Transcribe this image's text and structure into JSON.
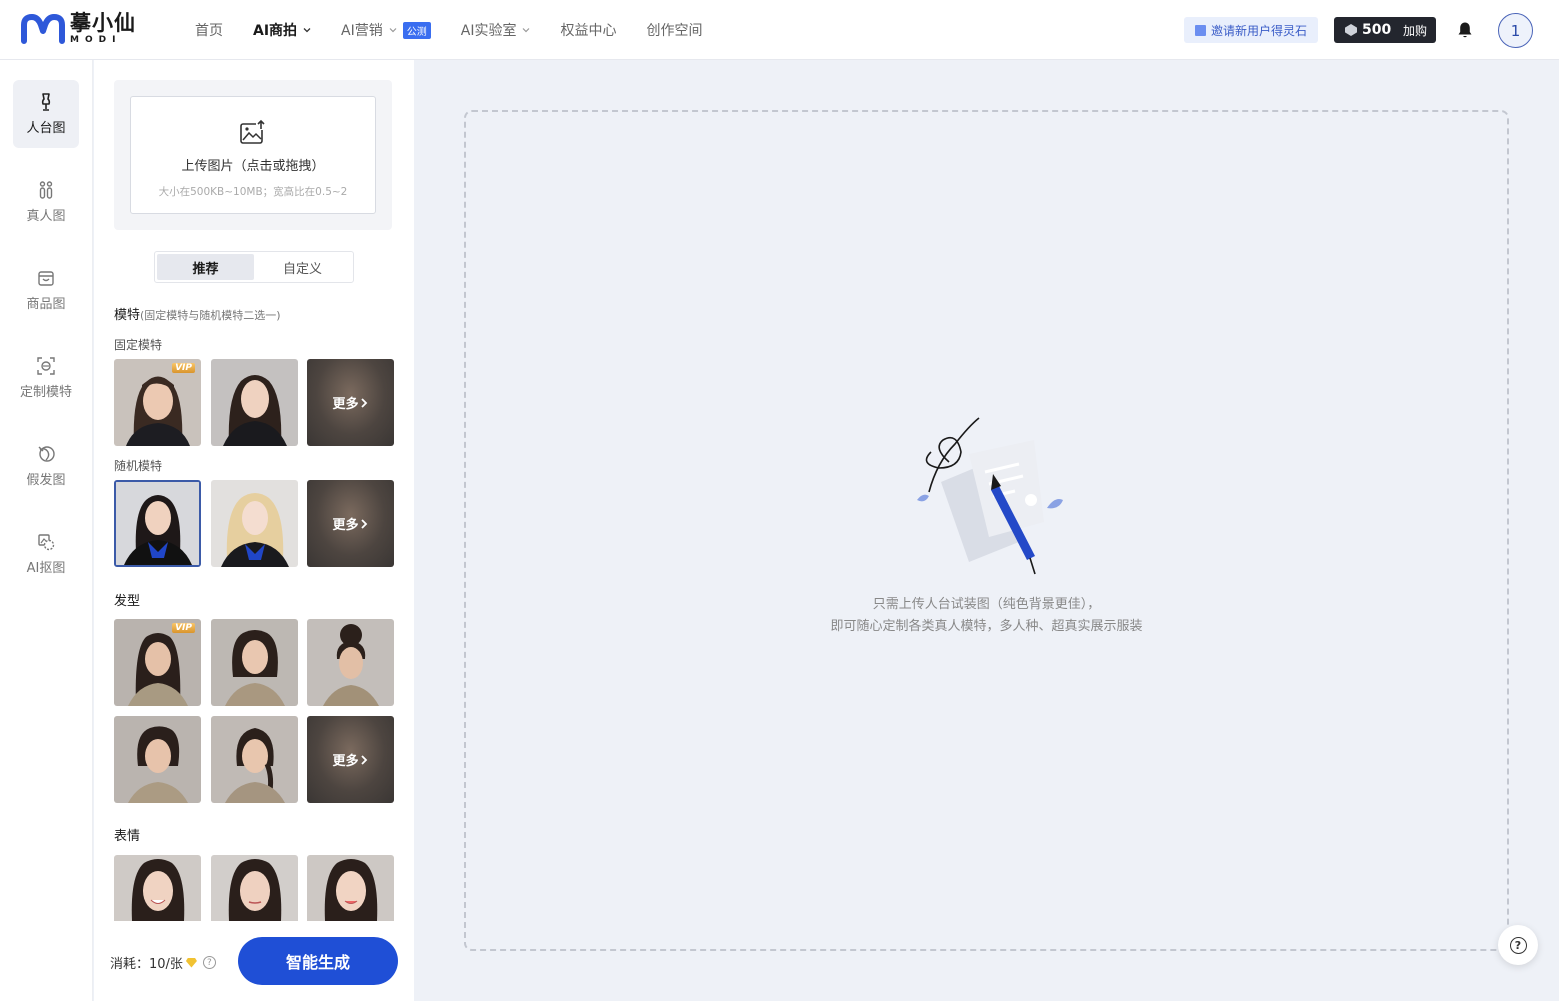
{
  "header": {
    "brand_cn": "摹小仙",
    "brand_en": "MODI",
    "nav": [
      {
        "label": "首页"
      },
      {
        "label": "AI商拍"
      },
      {
        "label": "AI营销",
        "badge": "公测"
      },
      {
        "label": "AI实验室"
      },
      {
        "label": "权益中心"
      },
      {
        "label": "创作空间"
      }
    ],
    "invite_label": "邀请新用户得灵石",
    "points_value": "500",
    "buy_label": "加购",
    "avatar_text": "1"
  },
  "sidebar": {
    "items": [
      {
        "label": "人台图",
        "icon": "mannequin-icon"
      },
      {
        "label": "真人图",
        "icon": "people-icon"
      },
      {
        "label": "商品图",
        "icon": "bag-icon"
      },
      {
        "label": "定制模特",
        "icon": "face-scan-icon"
      },
      {
        "label": "假发图",
        "icon": "wig-icon"
      },
      {
        "label": "AI抠图",
        "icon": "cutout-icon"
      }
    ],
    "active_index": 0
  },
  "panel": {
    "upload_title": "上传图片（点击或拖拽）",
    "upload_hint": "大小在500KB~10MB；宽高比在0.5~2",
    "tabs": [
      "推荐",
      "自定义"
    ],
    "model_title": "模特",
    "model_note": "(固定模特与随机模特二选一)",
    "fixed_model_label": "固定模特",
    "random_model_label": "随机模特",
    "hairstyle_label": "发型",
    "expression_label": "表情",
    "more_label": "更多",
    "vip_label": "VIP",
    "cost_label": "消耗：10/张",
    "generate_label": "智能生成"
  },
  "main": {
    "empty_line1": "只需上传人台试装图（纯色背景更佳），",
    "empty_line2": "即可随心定制各类真人模特，多人种、超真实展示服装"
  },
  "colors": {
    "accent": "#1f4fd6",
    "badge": "#3a6ef0",
    "vip_gold": "#e0a43c",
    "canvas_bg": "#eef1f7"
  }
}
